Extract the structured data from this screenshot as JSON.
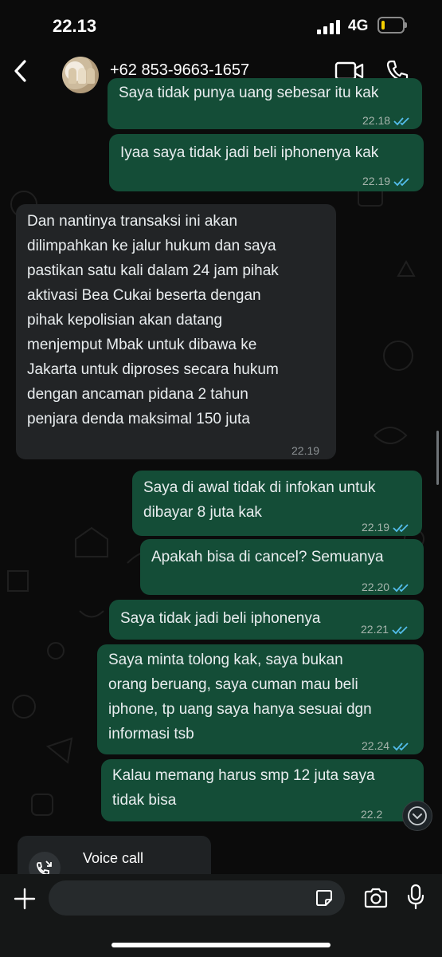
{
  "status_bar": {
    "time": "22.13",
    "network": "4G",
    "battery_level": 0.2
  },
  "header": {
    "contact": "+62 853-9663-1657",
    "back_icon": "chevron-left-icon",
    "video_icon": "video-camera-icon",
    "call_icon": "phone-icon"
  },
  "messages": [
    {
      "dir": "out",
      "text": "Saya tidak punya uang sebesar itu kak",
      "time": "22.18",
      "read": true
    },
    {
      "dir": "out",
      "text": "Iyaa saya tidak jadi beli iphonenya kak",
      "time": "22.19",
      "read": true
    },
    {
      "dir": "in",
      "lines": [
        "Dan nantinya transaksi ini akan",
        "dilimpahkan ke jalur hukum dan saya",
        "pastikan satu kali dalam 24 jam pihak",
        "aktivasi Bea Cukai beserta dengan",
        "pihak kepolisian akan datang",
        "menjemput Mbak untuk dibawa ke",
        "Jakarta untuk diproses secara hukum",
        "dengan ancaman pidana 2 tahun",
        "penjara denda maksimal 150 juta"
      ],
      "time": "22.19"
    },
    {
      "dir": "out",
      "lines": [
        "Saya di awal tidak di infokan untuk",
        "dibayar 8 juta kak"
      ],
      "time": "22.19",
      "read": true
    },
    {
      "dir": "out",
      "text": "Apakah bisa di cancel? Semuanya",
      "time": "22.20",
      "read": true
    },
    {
      "dir": "out",
      "text": "Saya tidak jadi beli iphonenya",
      "time": "22.21",
      "read": true
    },
    {
      "dir": "out",
      "lines": [
        "Saya minta tolong kak, saya bukan",
        "orang beruang, saya cuman mau beli",
        "iphone, tp uang saya hanya sesuai dgn",
        "informasi tsb"
      ],
      "time": "22.24",
      "read": true
    },
    {
      "dir": "out",
      "lines": [
        "Kalau memang harus smp 12 juta saya",
        "tidak bisa"
      ],
      "time": "22.2",
      "read": true
    }
  ],
  "call_card": {
    "label": "Voice call",
    "icon": "missed-call-icon"
  },
  "composer": {
    "placeholder": "",
    "plus_icon": "plus-icon",
    "sticker_icon": "sticker-icon",
    "camera_icon": "camera-icon",
    "mic_icon": "microphone-icon"
  },
  "colors": {
    "outgoing_bubble": "#144d37",
    "incoming_bubble": "#222426",
    "read_ticks": "#53bdeb"
  }
}
